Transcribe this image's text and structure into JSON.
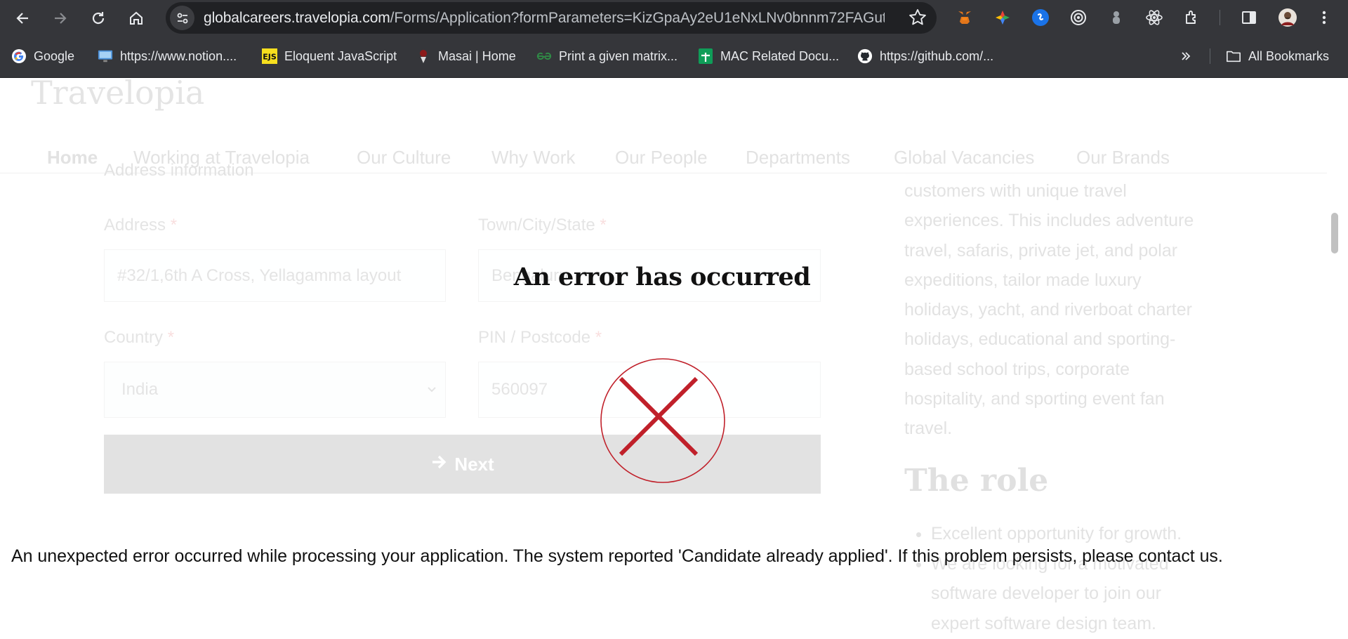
{
  "browser": {
    "url_host": "globalcareers.travelopia.com",
    "url_path": "/Forms/Application?formParameters=KizGpaAy2eU1eNxLNv0bnnm72FAGut...",
    "bookmarks": [
      {
        "label": "Google",
        "icon": "google-icon"
      },
      {
        "label": "https://www.notion....",
        "icon": "monitor-icon"
      },
      {
        "label": "Eloquent JavaScript",
        "icon": "ejs-icon"
      },
      {
        "label": "Masai | Home",
        "icon": "masai-icon"
      },
      {
        "label": "Print a given matrix...",
        "icon": "gfg-icon"
      },
      {
        "label": "MAC Related Docu...",
        "icon": "sheets-icon"
      },
      {
        "label": "https://github.com/...",
        "icon": "github-icon"
      }
    ],
    "all_bookmarks_label": "All Bookmarks"
  },
  "header": {
    "logo": "Travelopia",
    "nav": [
      "Home",
      "Working at Travelopia",
      "Our Culture",
      "Why Work",
      "Our People",
      "Departments",
      "Global Vacancies",
      "Our Brands"
    ]
  },
  "form": {
    "section_title": "Address information",
    "address_label": "Address",
    "address_value": "#32/1,6th A Cross, Yellagamma layout",
    "town_label": "Town/City/State",
    "town_value": "Bengaluru",
    "country_label": "Country",
    "country_value": "India",
    "pin_label": "PIN / Postcode",
    "pin_value": "560097",
    "required_mark": "*",
    "next_label": "Next"
  },
  "sidebar": {
    "intro_lines": [
      "customers with unique travel",
      "experiences. This includes adventure",
      "travel, safaris, private jet, and polar",
      "expeditions, tailor made luxury",
      "holidays, yacht, and riverboat charter",
      "holidays, educational and sporting-",
      "based school trips, corporate",
      "hospitality, and sporting event fan",
      "travel."
    ],
    "role_title": "The role",
    "role_items": [
      [
        "Excellent opportunity for growth."
      ],
      [
        "We are looking for a motivated",
        "software developer to join our",
        "expert software design team."
      ]
    ]
  },
  "error": {
    "title": "An error has occurred",
    "message": "An unexpected error occurred while processing your application. The system reported 'Candidate already applied'. If this problem persists, please contact us.",
    "color": "#c0202a"
  }
}
